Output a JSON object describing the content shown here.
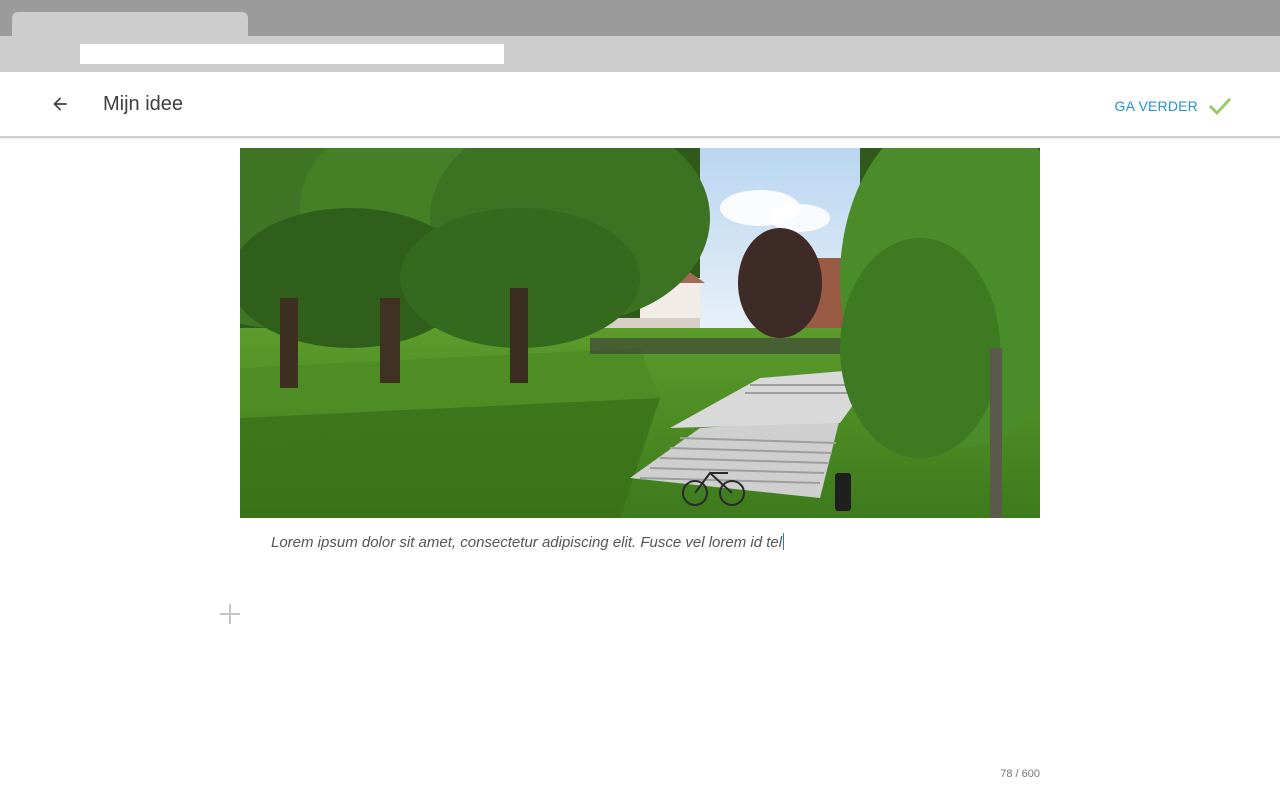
{
  "browser": {
    "tab_title": "",
    "address": ""
  },
  "header": {
    "back_icon": "arrow-left-icon",
    "title": "Mijn idee",
    "continue_label": "GA VERDER",
    "continue_icon": "checkmark-icon",
    "accent_color": "#1f95d8",
    "check_color": "#9ccc65"
  },
  "content": {
    "image_subject": "park-with-trees-grass-and-stairs",
    "caption": "Lorem ipsum dolor sit amet, consectetur adipiscing elit. Fusce vel lorem id tel",
    "add_icon": "plus-icon"
  },
  "footer": {
    "char_count": "78 / 600"
  }
}
